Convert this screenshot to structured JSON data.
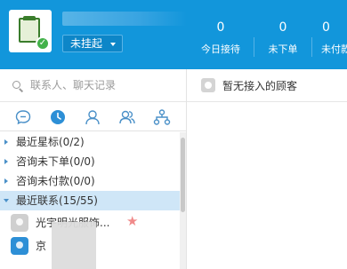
{
  "header": {
    "status_label": "未挂起",
    "stats": [
      {
        "value": "0",
        "label": "今日接待"
      },
      {
        "value": "0",
        "label": "未下单"
      },
      {
        "value": "0",
        "label": "未付款"
      }
    ]
  },
  "search": {
    "placeholder": "联系人、聊天记录"
  },
  "tabs": [
    {
      "icon": "chat-icon"
    },
    {
      "icon": "clock-icon"
    },
    {
      "icon": "person-icon"
    },
    {
      "icon": "group-icon"
    },
    {
      "icon": "org-icon"
    }
  ],
  "contact_groups": [
    {
      "label": "最近星标(0/2)",
      "expanded": false
    },
    {
      "label": "咨询未下单(0/0)",
      "expanded": false
    },
    {
      "label": "咨询未付款(0/0)",
      "expanded": false
    },
    {
      "label": "最近联系(15/55)",
      "expanded": true
    }
  ],
  "contacts": [
    {
      "name": "光宇明光服饰...",
      "starred": true
    },
    {
      "name": "京",
      "starred": false
    }
  ],
  "right_panel": {
    "message": "暂无接入的顾客"
  },
  "colors": {
    "header_bg": "#1296db",
    "selected_group_bg": "#cfe6f7",
    "star": "#f08a8a",
    "online_badge": "#43b14a"
  }
}
